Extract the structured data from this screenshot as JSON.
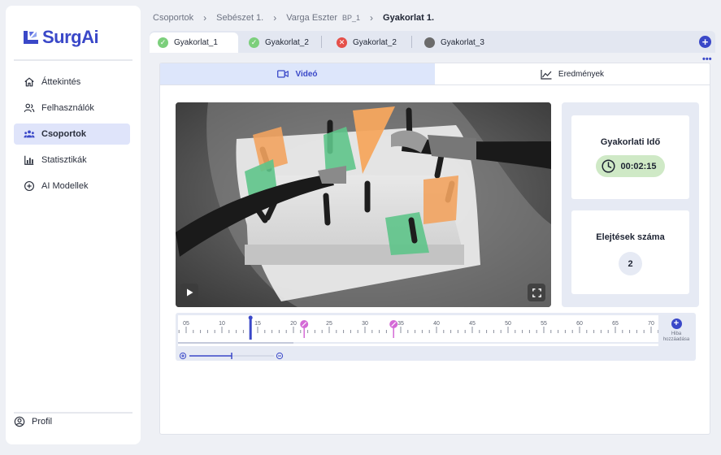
{
  "app": {
    "name": "SurgAi"
  },
  "sidebar": {
    "items": [
      {
        "label": "Áttekintés",
        "icon": "home-icon",
        "active": false
      },
      {
        "label": "Felhasználók",
        "icon": "users-icon",
        "active": false
      },
      {
        "label": "Csoportok",
        "icon": "group-icon",
        "active": true
      },
      {
        "label": "Statisztikák",
        "icon": "bar-chart-icon",
        "active": false
      },
      {
        "label": "AI Modellek",
        "icon": "plus-circle-icon",
        "active": false
      }
    ],
    "profile": {
      "label": "Profil",
      "icon": "profile-icon"
    }
  },
  "breadcrumb": {
    "items": [
      "Csoportok",
      "Sebészet 1.",
      "Varga Eszter",
      "BP_1",
      "Gyakorlat 1."
    ]
  },
  "tabs": [
    {
      "label": "Gyakorlat_1",
      "status": "success",
      "active": true
    },
    {
      "label": "Gyakorlat_2",
      "status": "success",
      "active": false
    },
    {
      "label": "Gyakorlat_2",
      "status": "error",
      "active": false
    },
    {
      "label": "Gyakorlat_3",
      "status": "pending",
      "active": false
    }
  ],
  "view_tabs": [
    {
      "label": "Videó",
      "icon": "video-icon",
      "active": true
    },
    {
      "label": "Eredmények",
      "icon": "line-chart-icon",
      "active": false
    }
  ],
  "stats": {
    "time_title": "Gyakorlati Idő",
    "time_value": "00:02:15",
    "drops_title": "Elejtések száma",
    "drops_value": "2"
  },
  "timeline": {
    "tick_labels": [
      "05",
      "10",
      "15",
      "20",
      "25",
      "30",
      "35",
      "40",
      "45",
      "50",
      "55",
      "60",
      "65",
      "70"
    ],
    "playhead": 14,
    "error_markers": [
      21.5,
      34
    ],
    "zoom_level": 0.5,
    "add_label_1": "Hiba",
    "add_label_2": "hozzáadása"
  },
  "colors": {
    "accent": "#3a48c8",
    "success": "#7ccf7c",
    "error": "#e5504a",
    "pending": "#6b6b6b",
    "marker": "#d46ad6"
  }
}
